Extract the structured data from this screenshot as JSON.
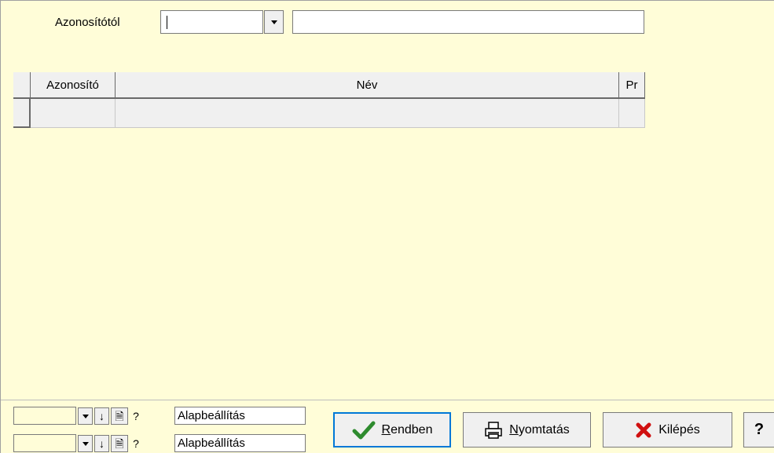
{
  "filter": {
    "label": "Azonosítótól",
    "id_value": "",
    "name_value": ""
  },
  "grid": {
    "columns": [
      "Azonosító",
      "Név",
      "Pr"
    ],
    "rows": [
      [
        "",
        "",
        ""
      ]
    ]
  },
  "footer": {
    "settings_rows": [
      {
        "value": "",
        "label": "Alapbeállítás"
      },
      {
        "value": "",
        "label": "Alapbeállítás"
      }
    ],
    "buttons": {
      "ok": "Rendben",
      "print": "Nyomtatás",
      "exit": "Kilépés",
      "help": "?"
    },
    "icons": {
      "down": "↓",
      "doc": "🗎",
      "question": "?"
    }
  },
  "colors": {
    "panel_bg": "#fffdd8",
    "button_bg": "#f0f0f0",
    "ok_check": "#2e8b2e",
    "exit_x": "#d01010"
  }
}
